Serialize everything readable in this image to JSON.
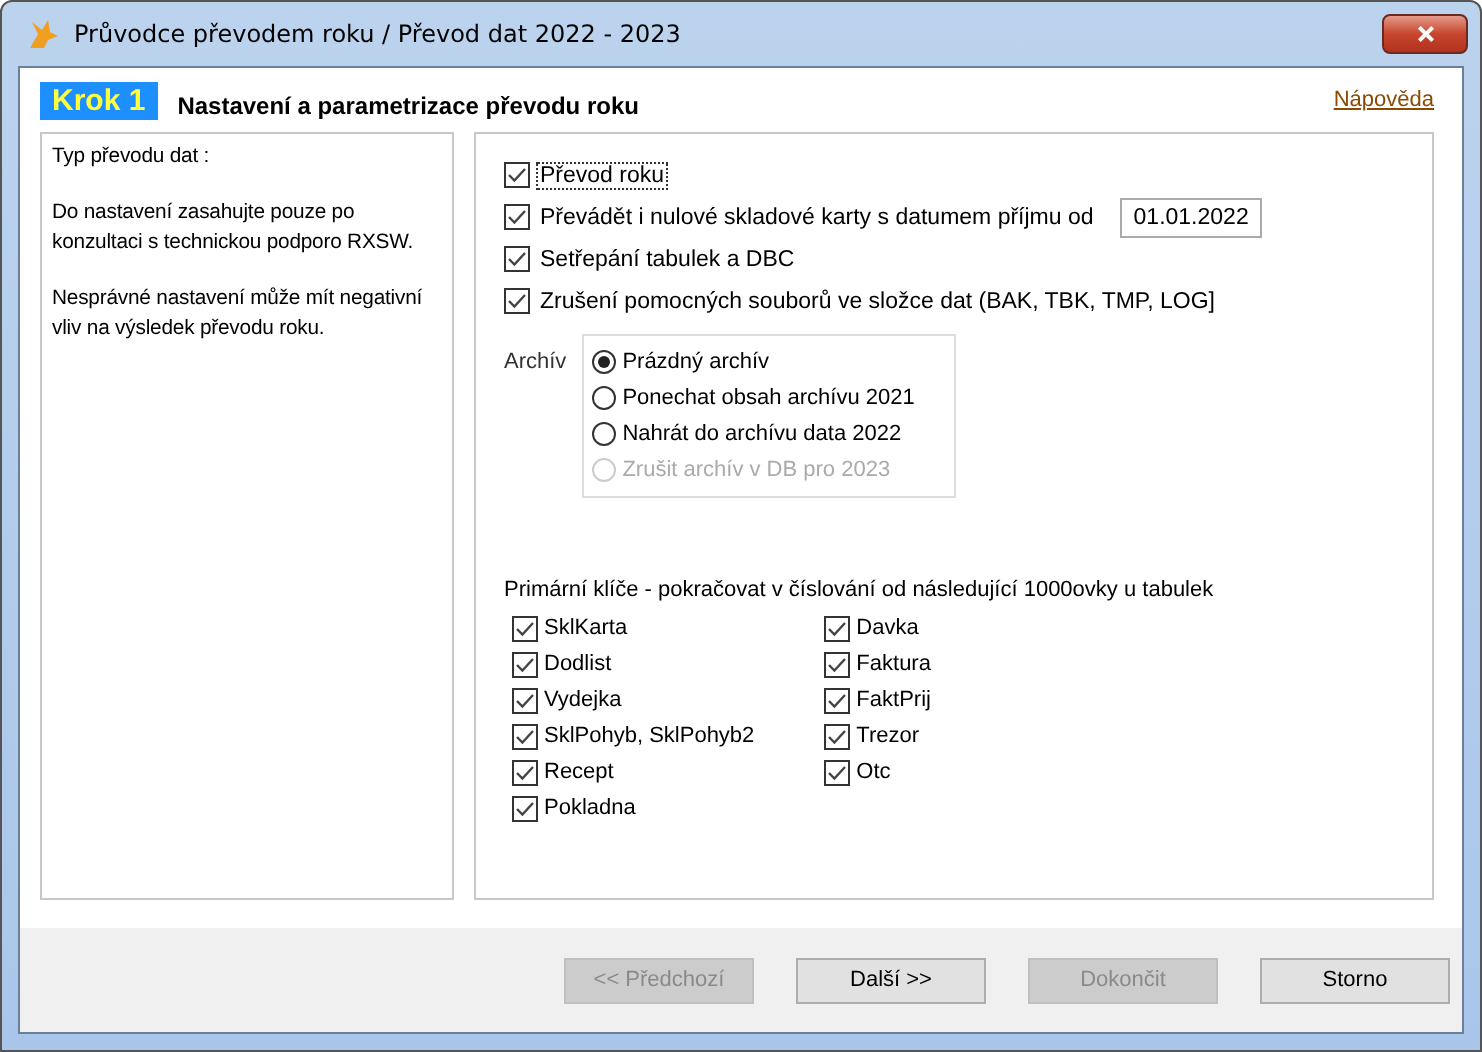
{
  "window": {
    "title": "Průvodce převodem roku / Převod dat 2022 - 2023"
  },
  "header": {
    "step": "Krok 1",
    "title": "Nastavení a parametrizace převodu roku",
    "help_link": "Nápověda"
  },
  "info_panel": {
    "paragraphs": [
      "Typ převodu dat :",
      "Do nastavení zasahujte pouze po konzultaci s technickou podporo RXSW.",
      "Nesprávné nastavení může mít negativní vliv na výsledek převodu roku."
    ]
  },
  "options": [
    {
      "label": "Převod roku",
      "checked": true,
      "focused": true
    },
    {
      "label": "Převádět i nulové skladové karty s datumem příjmu od",
      "checked": true,
      "focused": false,
      "date": "01.01.2022"
    },
    {
      "label": "Setřepání tabulek a DBC",
      "checked": true,
      "focused": false
    },
    {
      "label": "Zrušení pomocných souborů ve složce dat (BAK, TBK, TMP, LOG]",
      "checked": true,
      "focused": false
    }
  ],
  "archive": {
    "label": "Archív",
    "choices": [
      {
        "label": "Prázdný archív",
        "selected": true,
        "disabled": false
      },
      {
        "label": "Ponechat obsah archívu 2021",
        "selected": false,
        "disabled": false
      },
      {
        "label": "Nahrát do archívu data 2022",
        "selected": false,
        "disabled": false
      },
      {
        "label": "Zrušit archív v DB pro 2023",
        "selected": false,
        "disabled": true
      }
    ]
  },
  "primary_keys": {
    "label": "Primární klíče - pokračovat v číslování od následující 1000ovky u tabulek",
    "columns": [
      [
        {
          "label": "SklKarta",
          "checked": true
        },
        {
          "label": "Dodlist",
          "checked": true
        },
        {
          "label": "Vydejka",
          "checked": true
        },
        {
          "label": "SklPohyb, SklPohyb2",
          "checked": true
        },
        {
          "label": "Recept",
          "checked": true
        },
        {
          "label": "Pokladna",
          "checked": true
        }
      ],
      [
        {
          "label": "Davka",
          "checked": true
        },
        {
          "label": "Faktura",
          "checked": true
        },
        {
          "label": "FaktPrij",
          "checked": true
        },
        {
          "label": "Trezor",
          "checked": true
        },
        {
          "label": "Otc",
          "checked": true
        }
      ]
    ]
  },
  "buttons": [
    {
      "label": "<< Předchozí",
      "disabled": true
    },
    {
      "label": "Další >>",
      "disabled": false
    },
    {
      "label": "Dokončit",
      "disabled": true
    },
    {
      "label": "Storno",
      "disabled": false
    }
  ]
}
